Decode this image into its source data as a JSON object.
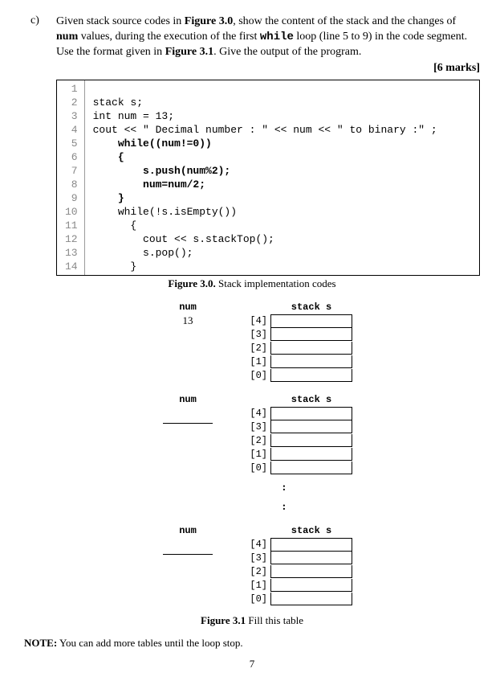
{
  "question": {
    "label": "c)",
    "text_1": "Given stack source codes in ",
    "fig30_ref": "Figure 3.0",
    "text_2": ", show the content of the stack and the changes of ",
    "num_bold": "num",
    "text_3": " values,  during the execution of the first ",
    "while_bold": "while",
    "text_4": " loop (line 5 to 9) in the code segment. Use the format given in ",
    "fig31_ref": "Figure 3.1",
    "text_5": ".  Give the output of the program.",
    "marks": "[6 marks]"
  },
  "code": {
    "linenos": [
      "1",
      "2",
      "3",
      "4",
      "5",
      "6",
      "7",
      "8",
      "9",
      "10",
      "11",
      "12",
      "13",
      "14"
    ],
    "lines": {
      "l1": "",
      "l2": "stack s;",
      "l3": "int num = 13;",
      "l4_a": "cout << \" Decimal number : \" << num << \" to binary :\" ;",
      "l5": "    while((num!=0))",
      "l6": "    {",
      "l7": "        s.push(num%2);",
      "l8": "        num=num/2;",
      "l9": "    }",
      "l10": "    while(!s.isEmpty())",
      "l11": "      {",
      "l12": "        cout << s.stackTop();",
      "l13": "        s.pop();",
      "l14": "      }"
    }
  },
  "fig30": {
    "bold": "Figure 3.0.",
    "rest": " Stack implementation codes"
  },
  "trace": {
    "num_hdr": "num",
    "stack_hdr": "stack s",
    "first_num": "13",
    "idx": [
      "[4]",
      "[3]",
      "[2]",
      "[1]",
      "[0]"
    ]
  },
  "dots": ":",
  "fig31": {
    "bold": "Figure 3.1",
    "rest": "  Fill this table"
  },
  "note": {
    "bold": "NOTE:",
    "rest": " You can add more tables until the loop stop."
  },
  "page": "7"
}
